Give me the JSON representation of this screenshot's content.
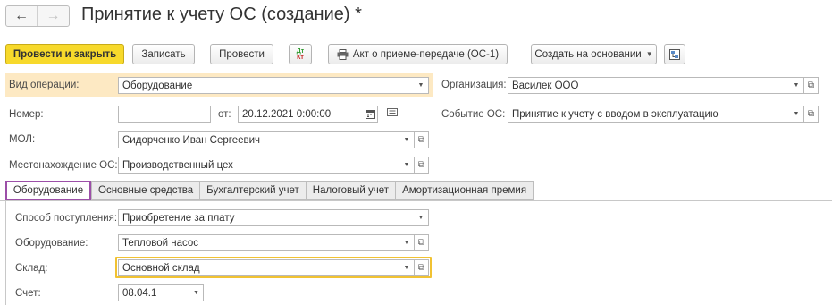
{
  "window": {
    "title": "Принятие к учету ОС (создание) *"
  },
  "nav": {
    "back_icon": "←",
    "forward_icon": "→"
  },
  "toolbar": {
    "post_and_close": "Провести и закрыть",
    "save": "Записать",
    "post": "Провести",
    "dtkt_top": "Дт",
    "dtkt_bottom": "Кт",
    "act_label": "Акт о приеме-передаче (ОС-1)",
    "create_based": "Создать на основании"
  },
  "form": {
    "operation_type": {
      "label": "Вид операции:",
      "value": "Оборудование"
    },
    "organization": {
      "label": "Организация:",
      "value": "Василек ООО"
    },
    "number": {
      "label": "Номер:",
      "value": ""
    },
    "date": {
      "label": "от:",
      "value": "20.12.2021  0:00:00"
    },
    "event": {
      "label": "Событие ОС:",
      "value": "Принятие к учету с вводом в эксплуатацию"
    },
    "mol": {
      "label": "МОЛ:",
      "value": "Сидорченко Иван Сергеевич"
    },
    "location": {
      "label": "Местонахождение ОС:",
      "value": "Производственный цех"
    }
  },
  "tabs": [
    {
      "label": "Оборудование"
    },
    {
      "label": "Основные средства"
    },
    {
      "label": "Бухгалтерский учет"
    },
    {
      "label": "Налоговый учет"
    },
    {
      "label": "Амортизационная премия"
    }
  ],
  "equipment_tab": {
    "receipt_method": {
      "label": "Способ поступления:",
      "value": "Приобретение за плату"
    },
    "equipment": {
      "label": "Оборудование:",
      "value": "Тепловой насос"
    },
    "warehouse": {
      "label": "Склад:",
      "value": "Основной склад"
    },
    "account": {
      "label": "Счет:",
      "value": "08.04.1"
    }
  },
  "colors": {
    "primary_button": "#f7d92b",
    "active_tab_border": "#9c4fa8",
    "warehouse_highlight": "#f1c232",
    "operation_row_bg": "#fde9c3"
  }
}
